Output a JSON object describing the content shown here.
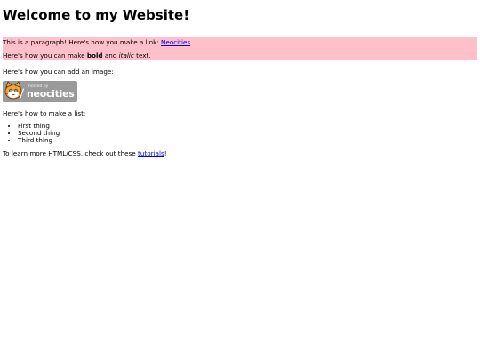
{
  "heading": "Welcome to my Website!",
  "pink_block": {
    "p1_text": "This is a paragraph! Here's how you make a link: ",
    "p1_link": "Neocities",
    "p1_end": ".",
    "p2_start": "Here's how you can make ",
    "p2_bold": "bold",
    "p2_mid": " and ",
    "p2_italic": "italic",
    "p2_end": " text."
  },
  "image_intro": "Here's how you can add an image:",
  "badge": {
    "small": "hosted by",
    "big": "neocities"
  },
  "list_intro": "Here's how to make a list:",
  "list_items": [
    "First thing",
    "Second thing",
    "Third thing"
  ],
  "footer": {
    "text": "To learn more HTML/CSS, check out these ",
    "link": "tutorials",
    "end": "!"
  },
  "colors": {
    "pink_background": "#ffc0cb",
    "link": "#0000ee",
    "badge_background": "#9a9a9a"
  },
  "icons": {
    "badge_mascot": "neocities-cat-icon"
  }
}
